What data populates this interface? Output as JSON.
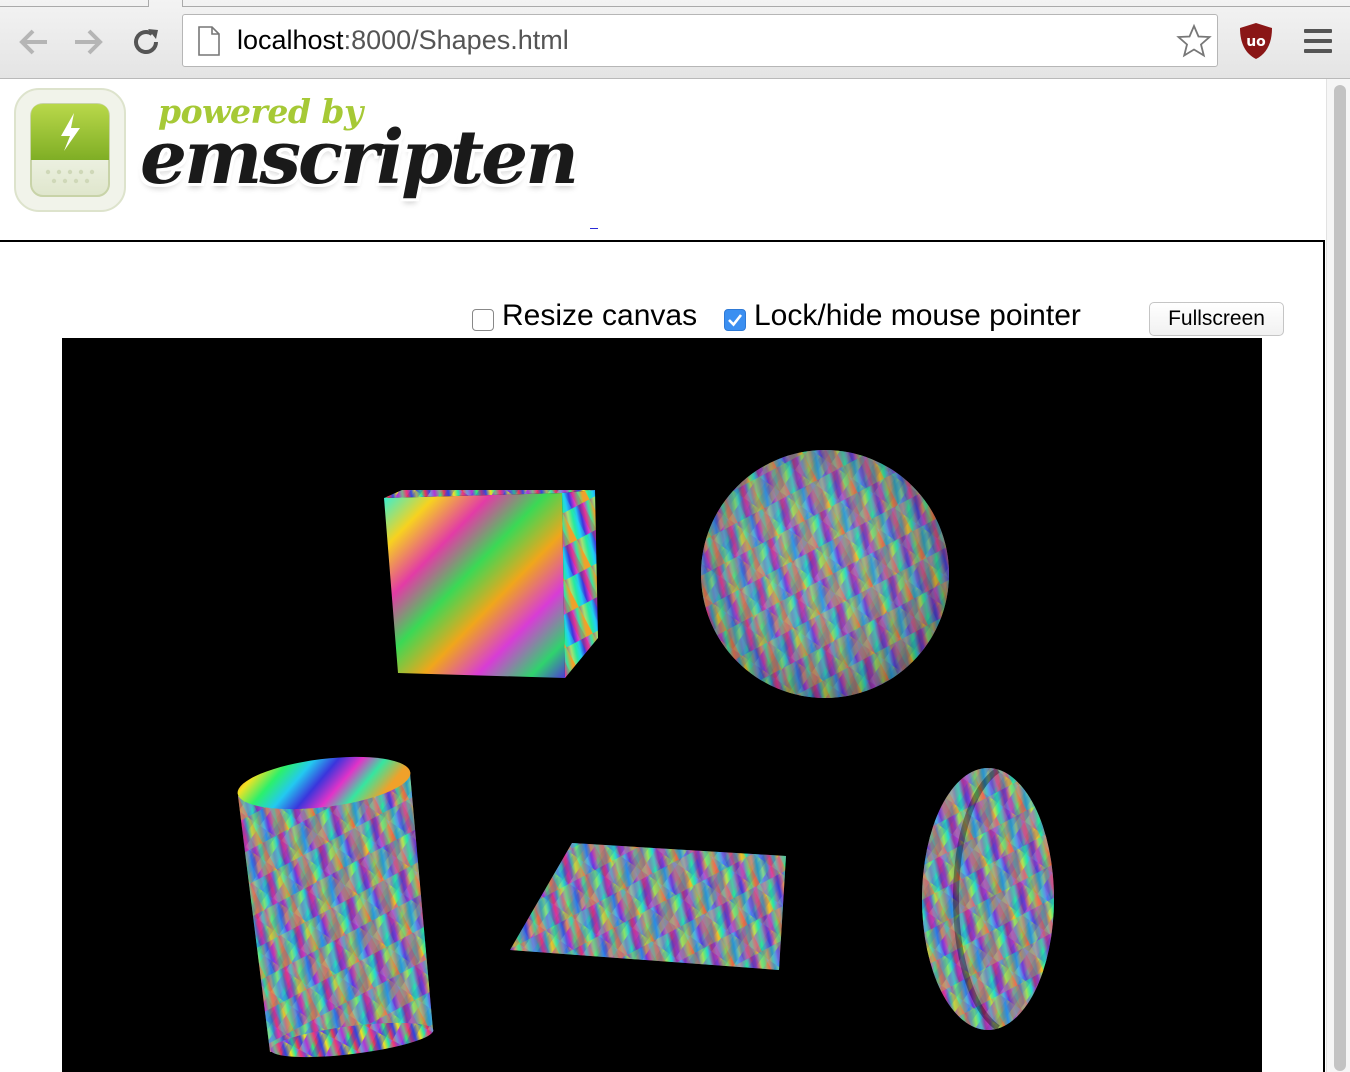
{
  "browser": {
    "url_host": "localhost",
    "url_rest": ":8000/Shapes.html",
    "icons": [
      "back-icon",
      "forward-icon",
      "reload-icon",
      "page-icon",
      "bookmark-star-icon",
      "ublock-icon",
      "menu-icon"
    ]
  },
  "header": {
    "powered_by": "powered by",
    "brand": "emscripten"
  },
  "controls": {
    "resize_label": "Resize canvas",
    "resize_checked": false,
    "lock_label": "Lock/hide mouse pointer",
    "lock_checked": true,
    "fullscreen_label": "Fullscreen"
  },
  "scene": {
    "background": "#000000",
    "shapes": [
      "cube",
      "sphere",
      "cylinder",
      "plane",
      "torus"
    ]
  }
}
